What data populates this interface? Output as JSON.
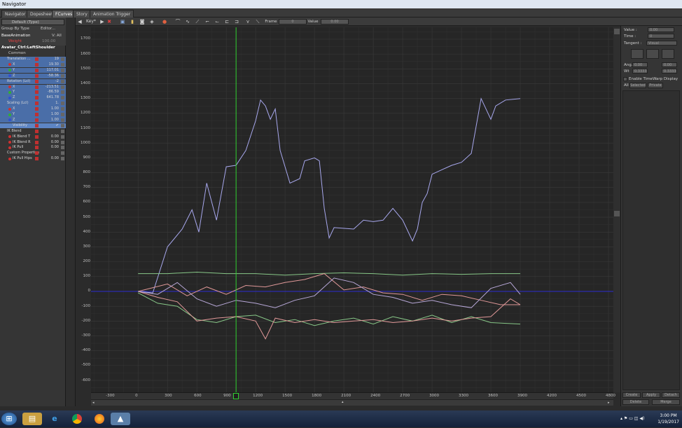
{
  "window": {
    "title": "Navigator"
  },
  "tabs": [
    {
      "label": "Navigator",
      "active": false
    },
    {
      "label": "Dopesheet",
      "active": false
    },
    {
      "label": "FCurves",
      "active": true
    },
    {
      "label": "Story",
      "active": false
    },
    {
      "label": "Animation Trigger",
      "active": false
    }
  ],
  "left_panel": {
    "take_select": "Default (Type)",
    "group_by": "Group By Type",
    "editor_label": "Editor...",
    "base_animation": "BaseAnimation",
    "base_v": "V: All",
    "weight_label": "Weight",
    "weight_value": "100.00",
    "object_name": "Avatar_Ctrl:LeftShoulder",
    "common": "Common",
    "rows": [
      {
        "label": "Translation ...",
        "value": "19",
        "type": "group",
        "row_class": "blue"
      },
      {
        "label": "X",
        "value": "19.30",
        "dot": "#d03030",
        "row_class": "blue"
      },
      {
        "label": "Y",
        "value": "117.01",
        "dot": "#30b030",
        "row_class": "blue"
      },
      {
        "label": "Z",
        "value": "-58.36",
        "dot": "#3050d0",
        "row_class": "blue"
      },
      {
        "label": "Rotation (Lcl)",
        "value": "-2",
        "type": "group",
        "row_class": "blue"
      },
      {
        "label": "X",
        "value": "-213.51",
        "dot": "#d03030",
        "row_class": "blue"
      },
      {
        "label": "Y",
        "value": "-86.59",
        "dot": "#30b030",
        "row_class": "blue"
      },
      {
        "label": "Z",
        "value": "641.78",
        "dot": "#3050d0",
        "row_class": "blue"
      },
      {
        "label": "Scaling (Lcl)",
        "value": "1.",
        "type": "group",
        "row_class": "blue"
      },
      {
        "label": "X",
        "value": "1.00",
        "dot": "#d03030",
        "row_class": "blue"
      },
      {
        "label": "Y",
        "value": "1.00",
        "dot": "#30b030",
        "row_class": "blue"
      },
      {
        "label": "Z",
        "value": "1.00",
        "dot": "#3050d0",
        "row_class": "blue"
      },
      {
        "label": "Visibility",
        "value": "✔",
        "row_class": "sel"
      },
      {
        "label": "IK Blend",
        "value": "",
        "type": "group",
        "row_class": ""
      },
      {
        "label": "IK Blend T",
        "value": "0.00",
        "dot": "#d03030",
        "row_class": ""
      },
      {
        "label": "IK Blend R",
        "value": "0.00",
        "dot": "#d03030",
        "row_class": ""
      },
      {
        "label": "IK Pull",
        "value": "0.00",
        "dot": "#d03030",
        "row_class": ""
      },
      {
        "label": "Custom Properties",
        "value": "",
        "type": "group",
        "row_class": ""
      },
      {
        "label": "IK Pull Hips",
        "value": "0.00",
        "dot": "#d03030",
        "row_class": ""
      }
    ]
  },
  "toolbar": {
    "key_label": "Key*",
    "frame_label": "Frame",
    "frame_value": "0",
    "value_label": "Value",
    "value_value": "0.00"
  },
  "right_panel": {
    "value_label": "Value :",
    "value_field": "0.00",
    "time_label": "Time :",
    "time_field": "0",
    "tangent_label": "Tangent :",
    "tangent_value": "Visual",
    "ang_label": "Ang.",
    "ang_field1": "0.00",
    "ang_field2": "0.00",
    "wt_label": "Wt",
    "wt_field1": "0.3333",
    "wt_field2": "0.3333",
    "timewarp_label": "Enable TimeWarp Display",
    "all_label": "All",
    "selected_label": "Selected",
    "private_label": "Private",
    "create_label": "Create",
    "apply_label": "Apply",
    "detach_label": "Detach",
    "delete_label": "Delete",
    "merge_label": "Merge"
  },
  "taskbar": {
    "time": "3:00 PM",
    "date": "1/19/2017"
  },
  "chart_data": {
    "type": "line",
    "title": "",
    "xlabel": "",
    "ylabel": "",
    "xlim": [
      -480,
      4850
    ],
    "ylim": [
      -680,
      1780
    ],
    "y_ticks": [
      1700,
      1600,
      1500,
      1400,
      1300,
      1200,
      1100,
      1000,
      900,
      800,
      700,
      600,
      500,
      400,
      300,
      200,
      100,
      0,
      -100,
      -200,
      -300,
      -400,
      -500,
      -600
    ],
    "x_ticks": [
      -300,
      0,
      300,
      600,
      900,
      1200,
      1500,
      1800,
      2100,
      2400,
      2700,
      3000,
      3300,
      3600,
      3900,
      4200,
      4500,
      4800
    ],
    "current_frame": 1000,
    "zero_line_color": "#2c2cd0",
    "series": [
      {
        "color": "#a8a8ee",
        "values": [
          [
            0,
            0
          ],
          [
            150,
            -10
          ],
          [
            300,
            300
          ],
          [
            450,
            420
          ],
          [
            550,
            550
          ],
          [
            620,
            400
          ],
          [
            700,
            730
          ],
          [
            800,
            480
          ],
          [
            900,
            840
          ],
          [
            1000,
            850
          ],
          [
            1100,
            950
          ],
          [
            1200,
            1150
          ],
          [
            1250,
            1290
          ],
          [
            1300,
            1250
          ],
          [
            1350,
            1160
          ],
          [
            1400,
            1230
          ],
          [
            1450,
            950
          ],
          [
            1550,
            730
          ],
          [
            1650,
            760
          ],
          [
            1700,
            880
          ],
          [
            1800,
            900
          ],
          [
            1850,
            880
          ],
          [
            1900,
            560
          ],
          [
            1950,
            360
          ],
          [
            2000,
            430
          ],
          [
            2200,
            420
          ],
          [
            2300,
            480
          ],
          [
            2400,
            470
          ],
          [
            2500,
            480
          ],
          [
            2600,
            560
          ],
          [
            2700,
            480
          ],
          [
            2800,
            340
          ],
          [
            2850,
            420
          ],
          [
            2900,
            600
          ],
          [
            2950,
            660
          ],
          [
            3000,
            790
          ],
          [
            3100,
            820
          ],
          [
            3200,
            850
          ],
          [
            3300,
            870
          ],
          [
            3400,
            930
          ],
          [
            3500,
            1300
          ],
          [
            3600,
            1160
          ],
          [
            3650,
            1250
          ],
          [
            3750,
            1290
          ],
          [
            3900,
            1300
          ]
        ]
      },
      {
        "color": "#88c888",
        "values": [
          [
            0,
            120
          ],
          [
            300,
            120
          ],
          [
            600,
            130
          ],
          [
            900,
            120
          ],
          [
            1200,
            120
          ],
          [
            1500,
            110
          ],
          [
            1800,
            120
          ],
          [
            2100,
            125
          ],
          [
            2400,
            120
          ],
          [
            2700,
            110
          ],
          [
            3000,
            120
          ],
          [
            3300,
            115
          ],
          [
            3600,
            120
          ],
          [
            3900,
            120
          ]
        ]
      },
      {
        "color": "#88c888",
        "values": [
          [
            0,
            -10
          ],
          [
            200,
            -80
          ],
          [
            400,
            -100
          ],
          [
            600,
            -190
          ],
          [
            800,
            -210
          ],
          [
            1000,
            -170
          ],
          [
            1200,
            -160
          ],
          [
            1400,
            -210
          ],
          [
            1600,
            -190
          ],
          [
            1800,
            -230
          ],
          [
            2000,
            -200
          ],
          [
            2200,
            -180
          ],
          [
            2400,
            -220
          ],
          [
            2600,
            -170
          ],
          [
            2800,
            -200
          ],
          [
            3000,
            -160
          ],
          [
            3200,
            -210
          ],
          [
            3400,
            -170
          ],
          [
            3600,
            -210
          ],
          [
            3900,
            -220
          ]
        ]
      },
      {
        "color": "#e09898",
        "values": [
          [
            0,
            0
          ],
          [
            200,
            -40
          ],
          [
            400,
            -70
          ],
          [
            600,
            -200
          ],
          [
            800,
            -180
          ],
          [
            1000,
            -170
          ],
          [
            1200,
            -200
          ],
          [
            1300,
            -320
          ],
          [
            1400,
            -180
          ],
          [
            1600,
            -210
          ],
          [
            1800,
            -190
          ],
          [
            2000,
            -210
          ],
          [
            2200,
            -200
          ],
          [
            2400,
            -190
          ],
          [
            2600,
            -210
          ],
          [
            2800,
            -200
          ],
          [
            3000,
            -180
          ],
          [
            3200,
            -200
          ],
          [
            3400,
            -180
          ],
          [
            3600,
            -170
          ],
          [
            3800,
            -50
          ],
          [
            3900,
            -90
          ]
        ]
      },
      {
        "color": "#e09898",
        "values": [
          [
            0,
            0
          ],
          [
            300,
            50
          ],
          [
            500,
            -30
          ],
          [
            700,
            30
          ],
          [
            900,
            -20
          ],
          [
            1100,
            40
          ],
          [
            1300,
            30
          ],
          [
            1500,
            60
          ],
          [
            1700,
            80
          ],
          [
            1900,
            120
          ],
          [
            2100,
            10
          ],
          [
            2300,
            30
          ],
          [
            2500,
            -10
          ],
          [
            2700,
            -20
          ],
          [
            2900,
            -60
          ],
          [
            3100,
            -20
          ],
          [
            3300,
            -30
          ],
          [
            3500,
            -60
          ],
          [
            3700,
            -90
          ],
          [
            3900,
            -90
          ]
        ]
      },
      {
        "color": "#b8a8d8",
        "values": [
          [
            0,
            0
          ],
          [
            200,
            -20
          ],
          [
            400,
            60
          ],
          [
            600,
            -50
          ],
          [
            800,
            -100
          ],
          [
            1000,
            -60
          ],
          [
            1200,
            -80
          ],
          [
            1400,
            -110
          ],
          [
            1600,
            -60
          ],
          [
            1800,
            -30
          ],
          [
            2000,
            90
          ],
          [
            2200,
            60
          ],
          [
            2400,
            -20
          ],
          [
            2600,
            -40
          ],
          [
            2800,
            -80
          ],
          [
            3000,
            -60
          ],
          [
            3200,
            -90
          ],
          [
            3400,
            -110
          ],
          [
            3600,
            20
          ],
          [
            3800,
            60
          ],
          [
            3900,
            -20
          ]
        ]
      }
    ]
  }
}
